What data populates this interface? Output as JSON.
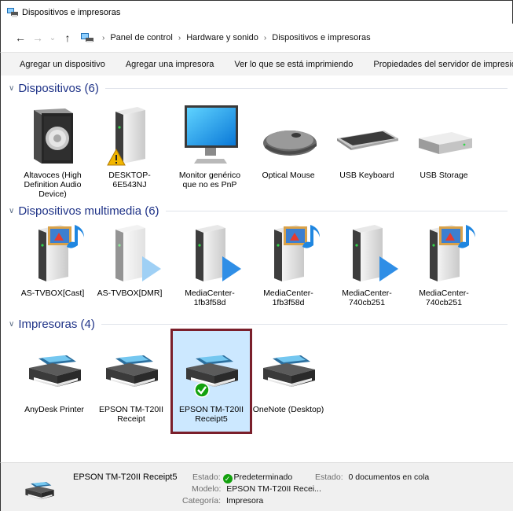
{
  "window": {
    "title": "Dispositivos e impresoras"
  },
  "address": {
    "crumbs": [
      "Panel de control",
      "Hardware y sonido",
      "Dispositivos e impresoras"
    ]
  },
  "toolbar": {
    "add_device": "Agregar un dispositivo",
    "add_printer": "Agregar una impresora",
    "see_printing": "Ver lo que se está imprimiendo",
    "server_props": "Propiedades del servidor de impresión"
  },
  "groups": {
    "devices": {
      "title": "Dispositivos (6)",
      "items": [
        {
          "label": "Altavoces (High Definition Audio Device)",
          "icon": "speaker-icon"
        },
        {
          "label": "DESKTOP-6E543NJ",
          "icon": "computer-tower-icon",
          "warning": true
        },
        {
          "label": "Monitor genérico que no es PnP",
          "icon": "monitor-icon"
        },
        {
          "label": "Optical Mouse",
          "icon": "mouse-icon"
        },
        {
          "label": "USB Keyboard",
          "icon": "keyboard-icon"
        },
        {
          "label": "USB Storage",
          "icon": "usb-storage-icon"
        }
      ]
    },
    "multimedia": {
      "title": "Dispositivos multimedia (6)",
      "items": [
        {
          "label": "AS-TVBOX[Cast]",
          "icon": "media-server-icon"
        },
        {
          "label": "AS-TVBOX[DMR]",
          "icon": "media-renderer-icon"
        },
        {
          "label": "MediaCenter-1fb3f58d",
          "icon": "media-renderer-icon"
        },
        {
          "label": "MediaCenter-1fb3f58d",
          "icon": "media-server-icon"
        },
        {
          "label": "MediaCenter-740cb251",
          "icon": "media-renderer-icon"
        },
        {
          "label": "MediaCenter-740cb251",
          "icon": "media-server-icon"
        }
      ]
    },
    "printers": {
      "title": "Impresoras (4)",
      "items": [
        {
          "label": "AnyDesk Printer",
          "icon": "printer-icon"
        },
        {
          "label": "EPSON TM-T20II Receipt",
          "icon": "printer-icon"
        },
        {
          "label": "EPSON TM-T20II Receipt5",
          "icon": "printer-icon",
          "default": true,
          "selected": true
        },
        {
          "label": "OneNote (Desktop)",
          "icon": "printer-icon"
        }
      ]
    }
  },
  "details": {
    "name": "EPSON TM-T20II Receipt5",
    "state_label": "Estado:",
    "state_value": "Predeterminado",
    "state2_label": "Estado:",
    "state2_value": "0 documentos en cola",
    "model_label": "Modelo:",
    "model_value": "EPSON TM-T20II Recei...",
    "category_label": "Categoría:",
    "category_value": "Impresora"
  },
  "colors": {
    "group_title": "#1e3287",
    "selection_fill": "#cce8ff",
    "selection_border": "#7a1f2b",
    "default_check": "#13a10e"
  }
}
